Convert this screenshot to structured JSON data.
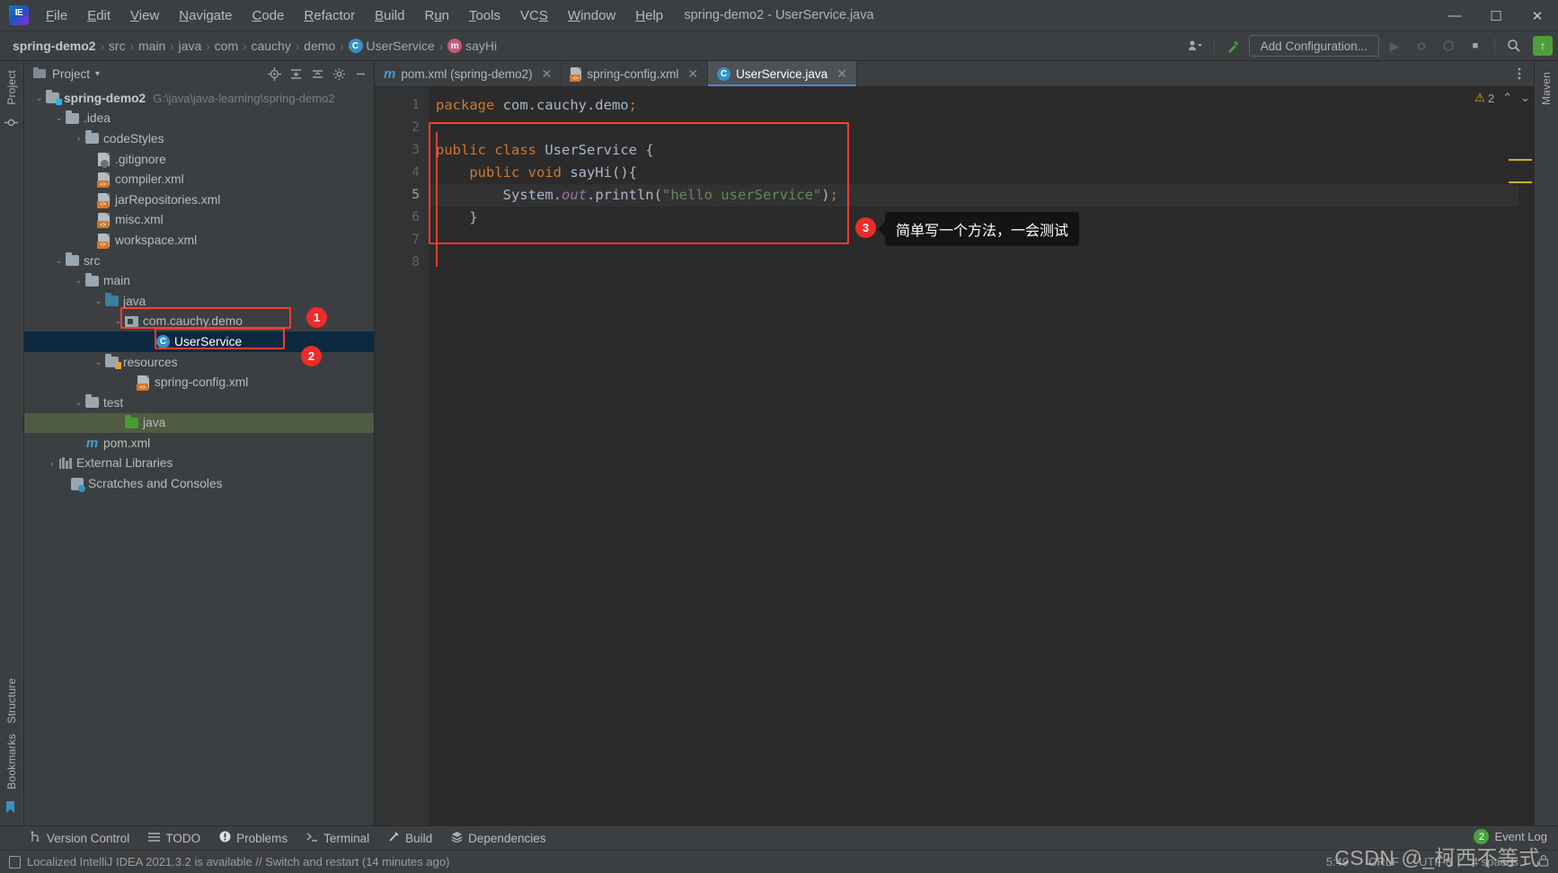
{
  "window": {
    "title": "spring-demo2 - UserService.java",
    "logo_text": "IE",
    "minimize": "—",
    "maximize": "☐",
    "close": "✕"
  },
  "menu": [
    {
      "label": "File"
    },
    {
      "label": "Edit"
    },
    {
      "label": "View"
    },
    {
      "label": "Navigate"
    },
    {
      "label": "Code"
    },
    {
      "label": "Refactor"
    },
    {
      "label": "Build"
    },
    {
      "label": "Run"
    },
    {
      "label": "Tools"
    },
    {
      "label": "VCS"
    },
    {
      "label": "Window"
    },
    {
      "label": "Help"
    }
  ],
  "breadcrumb": {
    "project": "spring-demo2",
    "items": [
      "src",
      "main",
      "java",
      "com",
      "cauchy",
      "demo"
    ],
    "class": {
      "badge": "C",
      "label": "UserService"
    },
    "method": {
      "badge": "m",
      "label": "sayHi"
    },
    "separator": "›"
  },
  "navbar_right": {
    "profile_icon": "user-dropdown-icon",
    "build_icon": "hammer-icon",
    "add_configuration": "Add Configuration...",
    "run_icon": "▶",
    "debug_icon": "debug-icon",
    "coverage_icon": "coverage-icon",
    "stop_icon": "■",
    "search_icon": "⌕",
    "update_icon": "↑"
  },
  "project_panel": {
    "title": "Project",
    "chevron": "▾",
    "tools": [
      "locate-icon",
      "collapse-all-icon",
      "expand-icon",
      "settings-gear-icon",
      "hide-icon"
    ],
    "tree": [
      {
        "indent": 0,
        "arrow": "⌄",
        "icon": "project-folder-icon",
        "label": "spring-demo2",
        "bold": true,
        "path": "G:\\java\\java-learning\\spring-demo2"
      },
      {
        "indent": 1,
        "arrow": "⌄",
        "icon": "folder-icon",
        "label": ".idea"
      },
      {
        "indent": 2,
        "arrow": "›",
        "icon": "folder-icon",
        "label": "codeStyles"
      },
      {
        "indent": 2,
        "arrow": "",
        "icon": "gitignore-file-icon",
        "label": ".gitignore"
      },
      {
        "indent": 2,
        "arrow": "",
        "icon": "xml-file-icon",
        "label": "compiler.xml"
      },
      {
        "indent": 2,
        "arrow": "",
        "icon": "xml-file-icon",
        "label": "jarRepositories.xml"
      },
      {
        "indent": 2,
        "arrow": "",
        "icon": "xml-file-icon",
        "label": "misc.xml"
      },
      {
        "indent": 2,
        "arrow": "",
        "icon": "xml-file-icon",
        "label": "workspace.xml"
      },
      {
        "indent": 1,
        "arrow": "⌄",
        "icon": "folder-icon",
        "label": "src"
      },
      {
        "indent": 2,
        "arrow": "⌄",
        "icon": "folder-icon",
        "label": "main"
      },
      {
        "indent": 3,
        "arrow": "⌄",
        "icon": "source-folder-icon",
        "label": "java"
      },
      {
        "indent": 4,
        "arrow": "⌄",
        "icon": "package-icon",
        "label": "com.cauchy.demo"
      },
      {
        "indent": 5,
        "arrow": "",
        "icon": "java-class-icon",
        "label": "UserService",
        "selected": true
      },
      {
        "indent": 3,
        "arrow": "⌄",
        "icon": "resources-folder-icon",
        "label": "resources"
      },
      {
        "indent": 4,
        "arrow": "",
        "icon": "xml-file-icon",
        "label": "spring-config.xml"
      },
      {
        "indent": 2,
        "arrow": "⌄",
        "icon": "folder-icon",
        "label": "test"
      },
      {
        "indent": 3,
        "arrow": "",
        "icon": "test-folder-icon",
        "label": "java",
        "greenish": true
      },
      {
        "indent": 1,
        "arrow": "",
        "icon": "maven-icon",
        "label": "pom.xml"
      },
      {
        "indent": 0,
        "arrow": "›",
        "icon": "external-libraries-icon",
        "label": "External Libraries"
      },
      {
        "indent": 0,
        "arrow": "",
        "icon": "scratches-icon",
        "label": "Scratches and Consoles"
      }
    ]
  },
  "editor_tabs": [
    {
      "icon": "maven-icon",
      "label": "pom.xml (spring-demo2)",
      "close": "✕",
      "active": false
    },
    {
      "icon": "xml-file-icon",
      "label": "spring-config.xml",
      "close": "✕",
      "active": false
    },
    {
      "icon": "java-class-icon",
      "label": "UserService.java",
      "close": "✕",
      "active": true
    }
  ],
  "editor": {
    "line_numbers": [
      "1",
      "2",
      "3",
      "4",
      "5",
      "6",
      "7",
      "8"
    ],
    "lines": [
      {
        "n": 1,
        "tokens": [
          {
            "t": "package",
            "c": "kw"
          },
          {
            "t": " com.cauchy.demo",
            "c": "pl"
          },
          {
            "t": ";",
            "c": "sem"
          }
        ]
      },
      {
        "n": 2,
        "tokens": []
      },
      {
        "n": 3,
        "tokens": [
          {
            "t": "public class ",
            "c": "kw"
          },
          {
            "t": "UserService ",
            "c": "cls"
          },
          {
            "t": "{",
            "c": "pl"
          }
        ]
      },
      {
        "n": 4,
        "tokens": [
          {
            "t": "    public void ",
            "c": "kw"
          },
          {
            "t": "sayHi",
            "c": "cls"
          },
          {
            "t": "(){",
            "c": "pl"
          }
        ]
      },
      {
        "n": 5,
        "tokens": [
          {
            "t": "        System.",
            "c": "pl"
          },
          {
            "t": "out",
            "c": "fld"
          },
          {
            "t": ".println(",
            "c": "pl"
          },
          {
            "t": "\"hello userService\"",
            "c": "str"
          },
          {
            "t": ")",
            "c": "pl"
          },
          {
            "t": ";",
            "c": "sem"
          }
        ]
      },
      {
        "n": 6,
        "tokens": [
          {
            "t": "    }",
            "c": "pl"
          }
        ]
      },
      {
        "n": 7,
        "tokens": []
      },
      {
        "n": 8,
        "tokens": []
      }
    ],
    "warning_count": "2",
    "warning_icon": "⚠",
    "nav_up": "⌃",
    "nav_down": "⌄"
  },
  "annotations": [
    {
      "id": "1",
      "number": "1",
      "target": "package-com-cauchy-demo"
    },
    {
      "id": "2",
      "number": "2",
      "target": "userservice-class-node"
    },
    {
      "id": "3",
      "number": "3",
      "target": "code-block",
      "tooltip": "简单写一个方法，一会测试"
    }
  ],
  "left_rail": {
    "top": [
      "Project"
    ],
    "bottom": [
      "Structure",
      "Bookmarks"
    ]
  },
  "right_rail": {
    "items": [
      "Maven"
    ]
  },
  "tool_windows": [
    {
      "icon": "version-control-icon",
      "label": "Version Control"
    },
    {
      "icon": "todo-icon",
      "label": "TODO"
    },
    {
      "icon": "problems-icon",
      "label": "Problems"
    },
    {
      "icon": "terminal-icon",
      "label": "Terminal"
    },
    {
      "icon": "build-icon",
      "label": "Build"
    },
    {
      "icon": "dependencies-icon",
      "label": "Dependencies"
    }
  ],
  "status_bar": {
    "message": "Localized IntelliJ IDEA 2021.3.2 is available // Switch and restart (14 minutes ago)",
    "message_icon": "notification-icon",
    "caret_position": "5:49",
    "line_separator": "CRLF",
    "encoding": "UTF-8",
    "indent": "4 spaces",
    "lock_icon": "lock-icon",
    "event_log": {
      "count": "2",
      "label": "Event Log"
    }
  },
  "watermark": "CSDN @_柯西不等式",
  "colors": {
    "accent": "#4a88c7",
    "annotation_red": "#ff3b30",
    "badge_red": "#ee2b2b",
    "selection": "#0d293e",
    "keyword": "#cc7832",
    "string": "#6a8759",
    "field": "#9876aa"
  }
}
